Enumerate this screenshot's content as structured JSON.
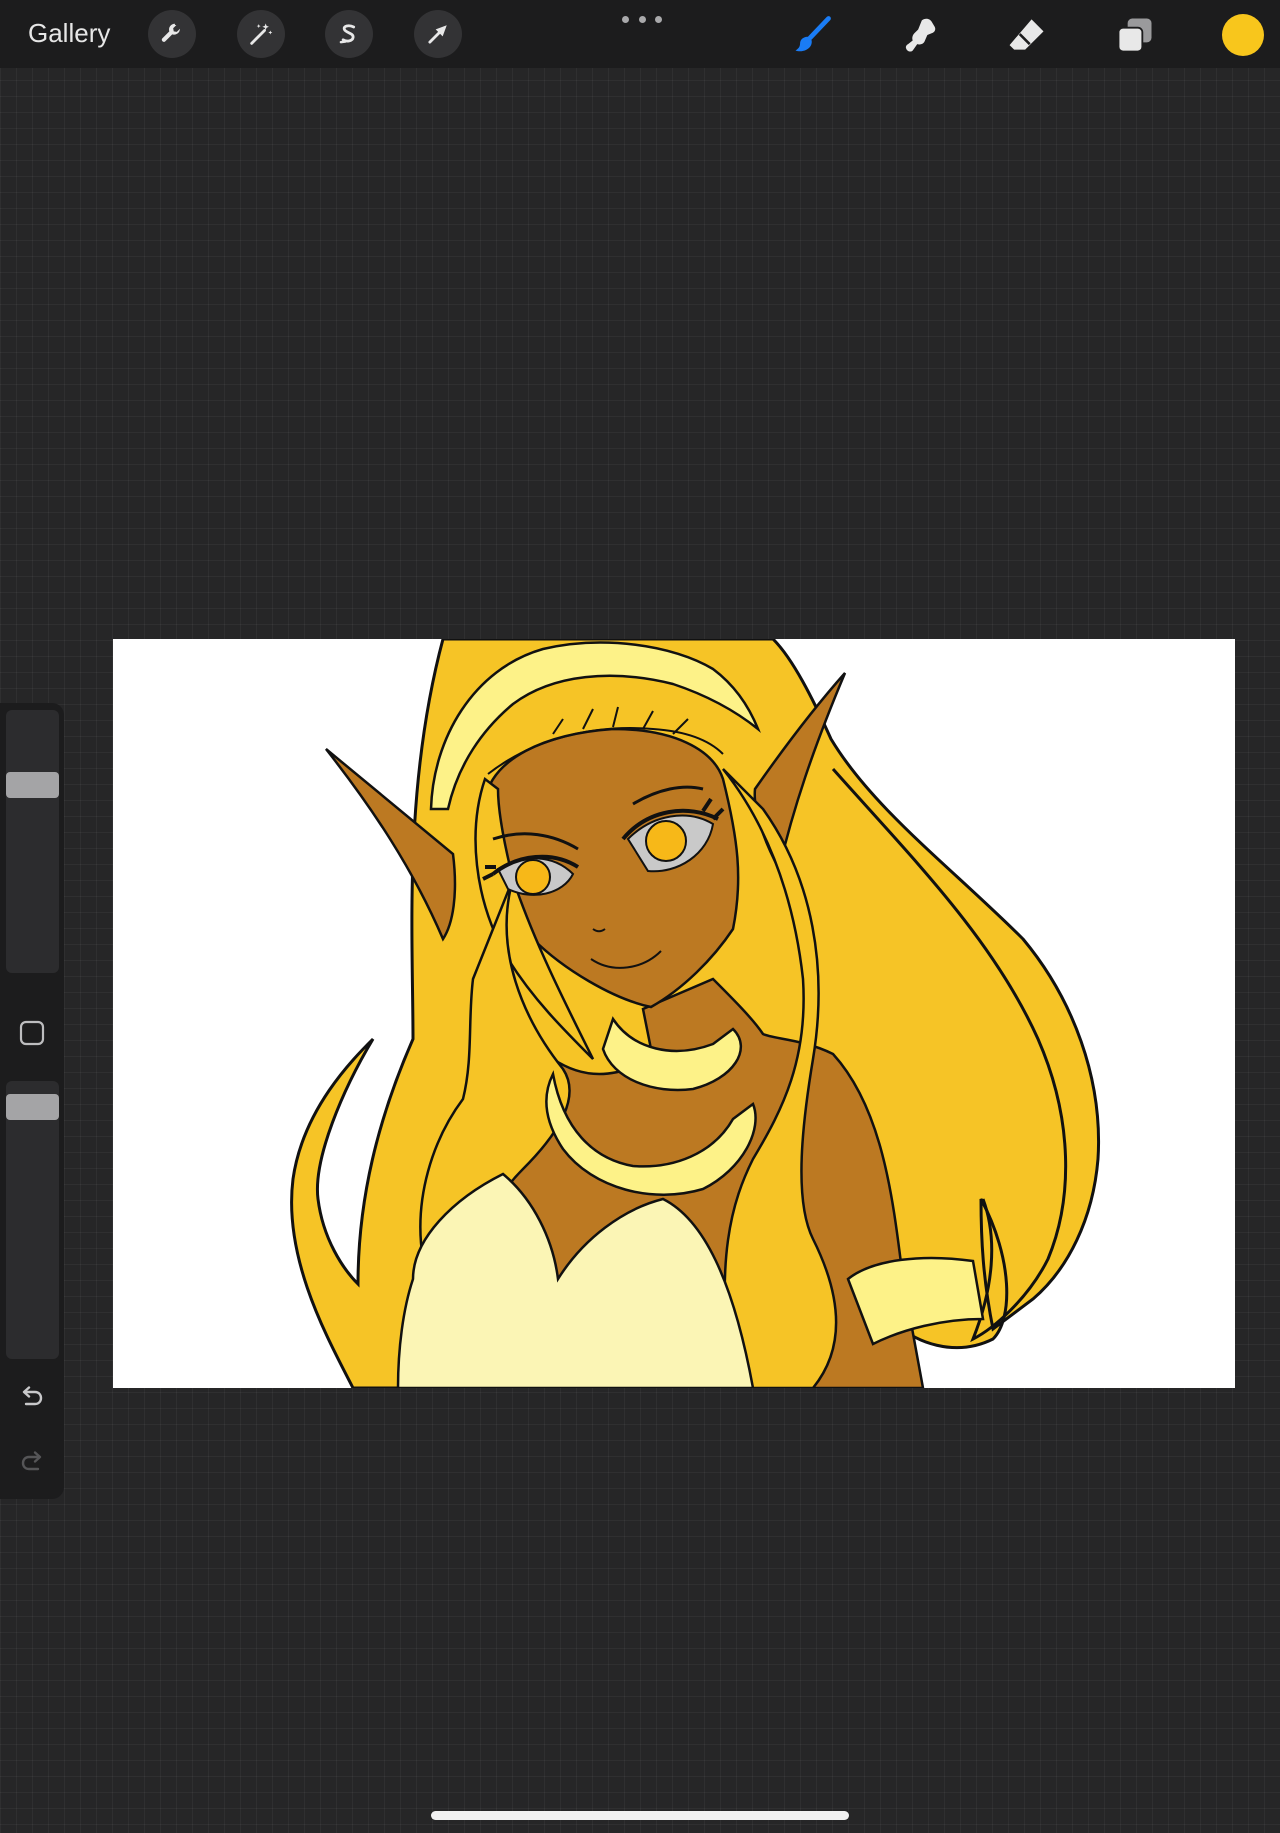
{
  "toolbar": {
    "gallery_label": "Gallery",
    "left_tools": [
      {
        "icon": "wrench-icon",
        "name": "actions"
      },
      {
        "icon": "magic-wand-icon",
        "name": "adjustments"
      },
      {
        "icon": "selection-s-icon",
        "name": "selection"
      },
      {
        "icon": "arrow-cursor-icon",
        "name": "transform"
      }
    ],
    "right_tools": [
      {
        "icon": "brush-icon",
        "name": "brush",
        "active": true
      },
      {
        "icon": "smudge-icon",
        "name": "smudge"
      },
      {
        "icon": "eraser-icon",
        "name": "eraser"
      },
      {
        "icon": "layers-icon",
        "name": "layers"
      }
    ]
  },
  "colors": {
    "accent": "#1a7cf5",
    "current_color": "#f8c61c",
    "toolbar_bg": "#1c1c1d",
    "hair": "#f6c426",
    "skin": "#bc7922",
    "headband": "#fdf288",
    "top": "#fbf5b5",
    "eye": "#f7b818"
  },
  "sidebar": {
    "brush_size_level": 0.74,
    "opacity_level": 0.95
  }
}
